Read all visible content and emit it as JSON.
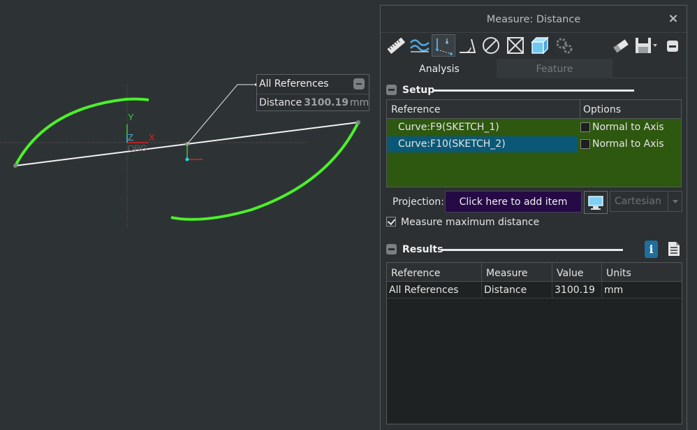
{
  "callout": {
    "title": "All References",
    "label": "Distance",
    "value": "3100.19",
    "unit": "mm"
  },
  "axes": {
    "y": "Y",
    "z": "Z",
    "x": "X",
    "origin": "ORG"
  },
  "panel": {
    "title": "Measure: Distance",
    "close": "×",
    "tabs": [
      "Analysis",
      "Feature"
    ],
    "active_tab": "Analysis",
    "toolbar_icons": [
      "ruler-icon",
      "curve-length-icon",
      "distance-icon",
      "angle-icon",
      "diameter-icon",
      "area-icon",
      "volume-icon",
      "transform-icon",
      "eraser-icon",
      "save-icon"
    ],
    "setup": {
      "title": "Setup",
      "columns": [
        "Reference",
        "Options"
      ],
      "rows": [
        {
          "reference": "Curve:F9(SKETCH_1)",
          "option": "Normal to Axis",
          "checked": false,
          "selected": false
        },
        {
          "reference": "Curve:F10(SKETCH_2)",
          "option": "Normal to Axis",
          "checked": false,
          "selected": true
        }
      ],
      "projection_label": "Projection:",
      "projection_value": "Click here to add item",
      "coordinate_system": "Cartesian",
      "max_distance_label": "Measure maximum distance",
      "max_distance_checked": true
    },
    "results": {
      "title": "Results",
      "columns": [
        "Reference",
        "Measure",
        "Value",
        "Units"
      ],
      "rows": [
        {
          "reference": "All References",
          "measure": "Distance",
          "value": "3100.19",
          "units": "mm"
        }
      ]
    }
  },
  "colors": {
    "background": "#2d3335",
    "curve": "#4cf02a",
    "selected_row": "#0b5876",
    "reference_row": "#2e5710",
    "projection_button": "#250a46",
    "info_button": "#1f6f9c"
  }
}
